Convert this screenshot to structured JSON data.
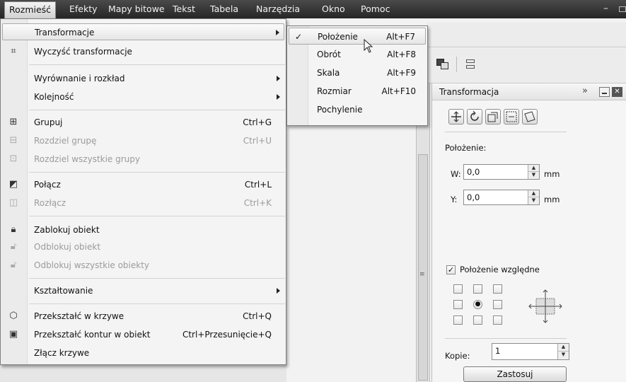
{
  "menubar": {
    "items": [
      {
        "label": "Rozmieść"
      },
      {
        "label": "Efekty"
      },
      {
        "label": "Mapy bitowe"
      },
      {
        "label": "Tekst"
      },
      {
        "label": "Tabela"
      },
      {
        "label": "Narzędzia"
      },
      {
        "label": "Okno"
      },
      {
        "label": "Pomoc"
      }
    ],
    "minimize": "–"
  },
  "main_menu": {
    "items": [
      {
        "label": "Transformacje",
        "shortcut": "",
        "submenu": true,
        "disabled": false,
        "icon": ""
      },
      {
        "label": "Wyczyść transformacje",
        "shortcut": "",
        "submenu": false,
        "disabled": false,
        "icon": "clear-transform-icon"
      },
      {
        "label": "Wyrównanie i rozkład",
        "shortcut": "",
        "submenu": true,
        "disabled": false,
        "icon": ""
      },
      {
        "label": "Kolejność",
        "shortcut": "",
        "submenu": true,
        "disabled": false,
        "icon": ""
      },
      {
        "label": "Grupuj",
        "shortcut": "Ctrl+G",
        "submenu": false,
        "disabled": false,
        "icon": "group-icon"
      },
      {
        "label": "Rozdziel grupę",
        "shortcut": "Ctrl+U",
        "submenu": false,
        "disabled": true,
        "icon": "ungroup-icon"
      },
      {
        "label": "Rozdziel wszystkie grupy",
        "shortcut": "",
        "submenu": false,
        "disabled": true,
        "icon": "ungroup-all-icon"
      },
      {
        "label": "Połącz",
        "shortcut": "Ctrl+L",
        "submenu": false,
        "disabled": false,
        "icon": "combine-icon"
      },
      {
        "label": "Rozłącz",
        "shortcut": "Ctrl+K",
        "submenu": false,
        "disabled": true,
        "icon": "break-apart-icon"
      },
      {
        "label": "Zablokuj obiekt",
        "shortcut": "",
        "submenu": false,
        "disabled": false,
        "icon": "lock-icon"
      },
      {
        "label": "Odblokuj obiekt",
        "shortcut": "",
        "submenu": false,
        "disabled": true,
        "icon": "unlock-icon"
      },
      {
        "label": "Odblokuj wszystkie obiekty",
        "shortcut": "",
        "submenu": false,
        "disabled": true,
        "icon": "unlock-all-icon"
      },
      {
        "label": "Kształtowanie",
        "shortcut": "",
        "submenu": true,
        "disabled": false,
        "icon": ""
      },
      {
        "label": "Przekształć w krzywe",
        "shortcut": "Ctrl+Q",
        "submenu": false,
        "disabled": false,
        "icon": "convert-to-curves-icon"
      },
      {
        "label": "Przekształć kontur w obiekt",
        "shortcut": "Ctrl+Przesunięcie+Q",
        "submenu": false,
        "disabled": false,
        "icon": "outline-to-object-icon"
      },
      {
        "label": "Złącz krzywe",
        "shortcut": "",
        "submenu": false,
        "disabled": false,
        "icon": ""
      }
    ]
  },
  "sub_menu": {
    "items": [
      {
        "label": "Położenie",
        "shortcut": "Alt+F7",
        "checked": true
      },
      {
        "label": "Obrót",
        "shortcut": "Alt+F8",
        "checked": false
      },
      {
        "label": "Skala",
        "shortcut": "Alt+F9",
        "checked": false
      },
      {
        "label": "Rozmiar",
        "shortcut": "Alt+F10",
        "checked": false
      },
      {
        "label": "Pochylenie",
        "shortcut": "",
        "checked": false
      }
    ],
    "check_mark": "✓"
  },
  "docker": {
    "title": "Transformacja",
    "section_label": "Położenie:",
    "w_label": "W:",
    "w_value": "0,0",
    "w_unit": "mm",
    "y_label": "Y:",
    "y_value": "0,0",
    "y_unit": "mm",
    "relative_label": "Położenie względne",
    "relative_checked": true,
    "copies_label": "Kopie:",
    "copies_value": "1",
    "apply_label": "Zastosuj",
    "expand_glyph": "»"
  }
}
